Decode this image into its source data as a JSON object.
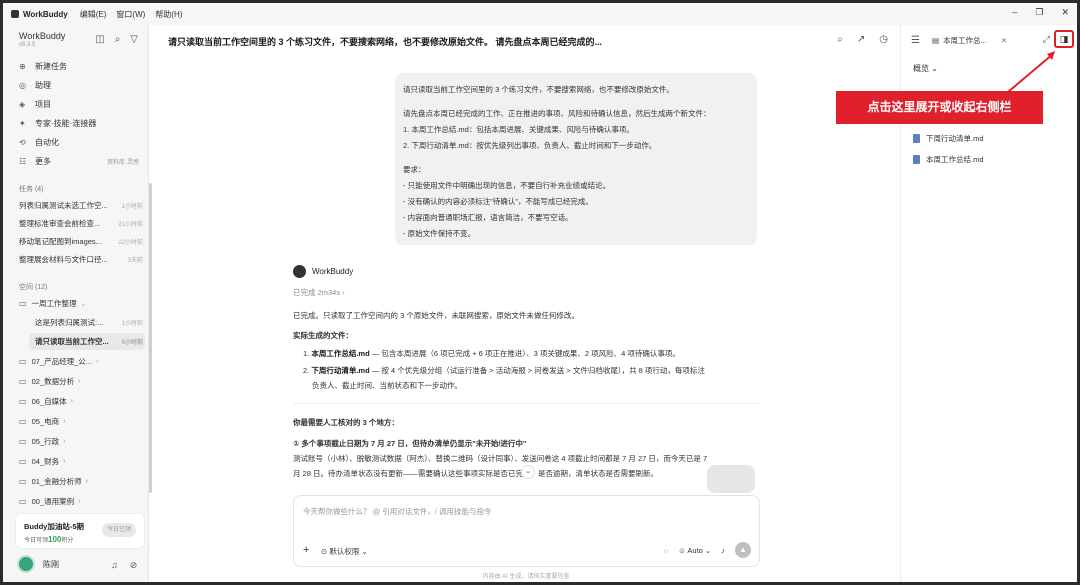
{
  "titlebar": {
    "app": "WorkBuddy",
    "menus": [
      "编辑(E)",
      "窗口(W)",
      "帮助(H)"
    ],
    "controls": [
      "–",
      "❐",
      "✕"
    ]
  },
  "sidebar": {
    "brand": "WorkBuddy",
    "version": "v5.3.5",
    "nav": [
      {
        "icon": "⊕",
        "label": "新建任务",
        "side": ""
      },
      {
        "icon": "◎",
        "label": "助理",
        "side": ""
      },
      {
        "icon": "◈",
        "label": "项目",
        "side": ""
      },
      {
        "icon": "✦",
        "label": "专家·技能·连接器",
        "side": ""
      },
      {
        "icon": "⟲",
        "label": "自动化",
        "side": ""
      },
      {
        "icon": "☷",
        "label": "更多",
        "side": "资料库·灵感"
      }
    ],
    "tasks_header": "任务 (4)",
    "tasks": [
      {
        "label": "列表归属测试未选工作空...",
        "time": "1小时前"
      },
      {
        "label": "整理标准审查会前检查...",
        "time": "21小时前"
      },
      {
        "label": "移动笔记配图到images...",
        "time": "22小时前"
      },
      {
        "label": "整理展会材料与文件口径...",
        "time": "3天前"
      }
    ],
    "spaces_header": "空间 (12)",
    "folders": [
      {
        "label": "一周工作整理"
      },
      {
        "label": "07_产品经理_公..."
      },
      {
        "label": "02_数据分析"
      },
      {
        "label": "06_自媒体"
      },
      {
        "label": "05_电商"
      },
      {
        "label": "05_行政"
      },
      {
        "label": "04_财务"
      },
      {
        "label": "01_金融分析师"
      },
      {
        "label": "00_通用案例"
      }
    ],
    "subitems": [
      {
        "label": "这是列表归属测试:...",
        "time": "1小时前"
      },
      {
        "label": "请只读取当前工作空...",
        "time": "5小时前"
      }
    ],
    "promo": {
      "title": "Buddy加油站-5期",
      "line_prefix": "今日可领",
      "amount": "100",
      "line_suffix": "积分",
      "button": "今日已领"
    },
    "user": "陈刚"
  },
  "main": {
    "title": "请只读取当前工作空间里的 3 个练习文件，不要搜索网络，也不要修改原始文件。 请先盘点本周已经完成的...",
    "bubble_lines": [
      "请只读取当前工作空间里的 3 个练习文件，不要搜索网络，也不要修改原始文件。",
      "",
      "请先盘点本周已经完成的工作、正在推进的事项、风险和待确认信息，然后生成两个新文件：",
      "1. 本周工作总结.md：包括本周进展、关键成果、风险与待确认事项。",
      "2. 下周行动清单.md：按优先级列出事项、负责人、截止时间和下一步动作。",
      "",
      "要求：",
      "- 只能使用文件中明确出现的信息，不要自行补充业绩或结论。",
      "- 没有确认的内容必须标注\"待确认\"，不能写成已经完成。",
      "- 内容面向普通职场汇报，语言简洁，不要写空话。",
      "- 原始文件保持不变。"
    ],
    "bot_name": "WorkBuddy",
    "done": "已完成 2m34s",
    "resp": {
      "p1": "已完成。只读取了工作空间内的 3 个原始文件，未联网搜索，原始文件未做任何修改。",
      "h1": "实际生成的文件：",
      "f1_name": "本周工作总结.md",
      "f1_desc": " — 包含本周进展（6 项已完成 + 6 项正在推进）、3 项关键成果、2 项风险、4 项待确认事项。",
      "f2_name": "下周行动清单.md",
      "f2_desc": " — 按 4 个优先级分组（试运行准备 > 活动海报 > 问卷发送 > 文件归档收尾），共 8 项行动，每项标注",
      "f2_desc2": "负责人、截止时间、当前状态和下一步动作。",
      "h2": "你最需要人工核对的 3 个地方：",
      "i1": "① 多个事项截止日期为 7 月 27 日，但待办清单仍显示\"未开始/进行中\"",
      "i1_l1": "测试账号（小林）、脱敏测试数据（阿杰）、替换二维码（设计同事）、发送问卷这 4 项截止时间都是 7 月 27 日，而今天已是 7",
      "i1_l2": "月 28 日。待办清单状态没有更新——需要确认这些事项实际是否已完成，是否逾期，清单状态是否需要刷新。"
    },
    "input": {
      "placeholder": "今天帮你做些什么？ @ 引用对话文件，/ 调用技能与指令",
      "plus": "+",
      "permission": "默认权限",
      "mode": "Auto",
      "send": "▲"
    },
    "footer": "内容由 AI 生成，请核实重要信息"
  },
  "right_panel": {
    "tab": "本周工作总...",
    "overview": "概览",
    "files": [
      "下周行动清单.md",
      "本周工作总结.md"
    ]
  },
  "annotation": "点击这里展开或收起右侧栏",
  "colors": {
    "accent_red": "#e0202a",
    "green": "#2da55d"
  }
}
